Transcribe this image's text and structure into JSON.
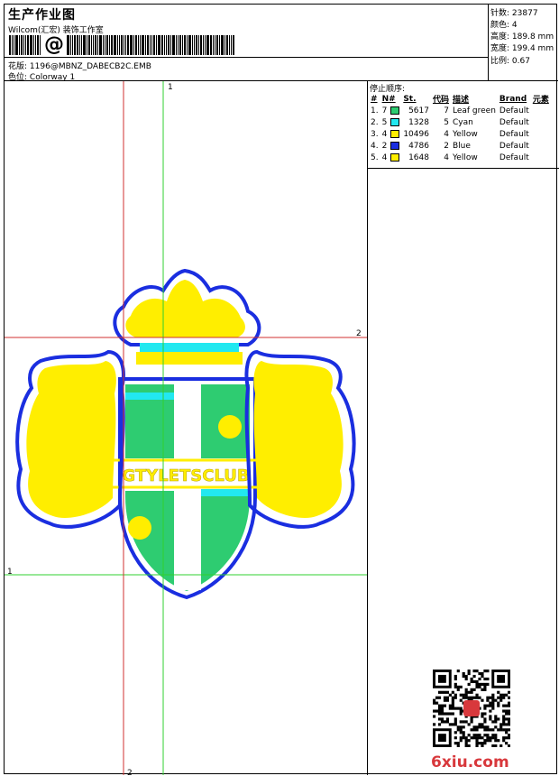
{
  "header": {
    "title": "生产作业图",
    "company": "Wilcom(汇宏) 装饰工作室",
    "barcode_symbol": "@",
    "design_label": "花版:",
    "design_value": "1196@MBNZ_DABECB2C.EMB",
    "colorway_label": "色位:",
    "colorway_value": "Colorway 1"
  },
  "stats": [
    {
      "label": "针数:",
      "value": "23877"
    },
    {
      "label": "颜色:",
      "value": "4"
    },
    {
      "label": "高度:",
      "value": "189.8 mm"
    },
    {
      "label": "宽度:",
      "value": "199.4 mm"
    },
    {
      "label": "比例:",
      "value": "0.67"
    }
  ],
  "legend": {
    "title": "停止顺序:",
    "columns": [
      "#",
      "N#",
      "St.",
      "代码",
      "描述",
      "Brand",
      "元素"
    ],
    "rows": [
      {
        "idx": "1.",
        "n": "7",
        "color": "#2ecc71",
        "st": "5617",
        "code": "7",
        "desc": "Leaf green",
        "brand": "Default"
      },
      {
        "idx": "2.",
        "n": "5",
        "color": "#22e8f0",
        "st": "1328",
        "code": "5",
        "desc": "Cyan",
        "brand": "Default"
      },
      {
        "idx": "3.",
        "n": "4",
        "color": "#ffee00",
        "st": "10496",
        "code": "4",
        "desc": "Yellow",
        "brand": "Default"
      },
      {
        "idx": "4.",
        "n": "2",
        "color": "#1a2ee0",
        "st": "4786",
        "code": "2",
        "desc": "Blue",
        "brand": "Default"
      },
      {
        "idx": "5.",
        "n": "4",
        "color": "#ffee00",
        "st": "1648",
        "code": "4",
        "desc": "Yellow",
        "brand": "Default"
      }
    ]
  },
  "design": {
    "banner_text": "GTYLETSCLUB",
    "guide_labels": {
      "v1": "1",
      "h2": "2",
      "h1": "1",
      "v2": "2"
    },
    "colors": {
      "blue": "#1a2ee0",
      "yellow": "#ffee00",
      "green": "#2ecc71",
      "cyan": "#22e8f0",
      "guide_red": "#d03030",
      "guide_green": "#30d030"
    }
  },
  "watermark": {
    "site": "6xiu.com"
  }
}
